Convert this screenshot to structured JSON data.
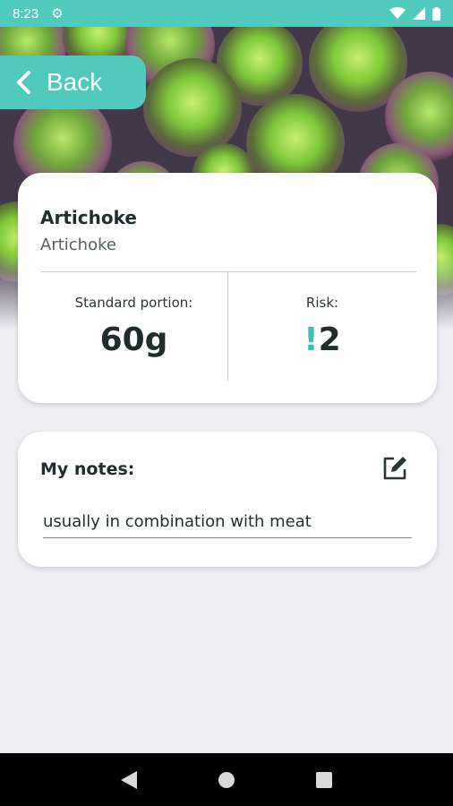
{
  "status_bar": {
    "time": "8:23"
  },
  "header": {
    "back_label": "Back"
  },
  "food": {
    "title": "Artichoke",
    "subtitle": "Artichoke",
    "portion_label": "Standard portion:",
    "portion_value": "60g",
    "risk_label": "Risk:",
    "risk_mark": "!",
    "risk_value": "2"
  },
  "notes": {
    "title": "My notes:",
    "value": "usually in combination with meat"
  },
  "colors": {
    "accent": "#4fcabd",
    "background": "#eeeef3",
    "text": "#1f2d2d",
    "risk_mark": "#3fbfb1"
  },
  "icons": {
    "status": [
      "settings-gear-icon",
      "wifi-icon",
      "cellular-signal-icon",
      "battery-icon"
    ],
    "back": "chevron-left-icon",
    "notes_edit": "edit-pencil-icon",
    "nav": [
      "nav-back-icon",
      "nav-home-icon",
      "nav-recents-icon"
    ]
  }
}
